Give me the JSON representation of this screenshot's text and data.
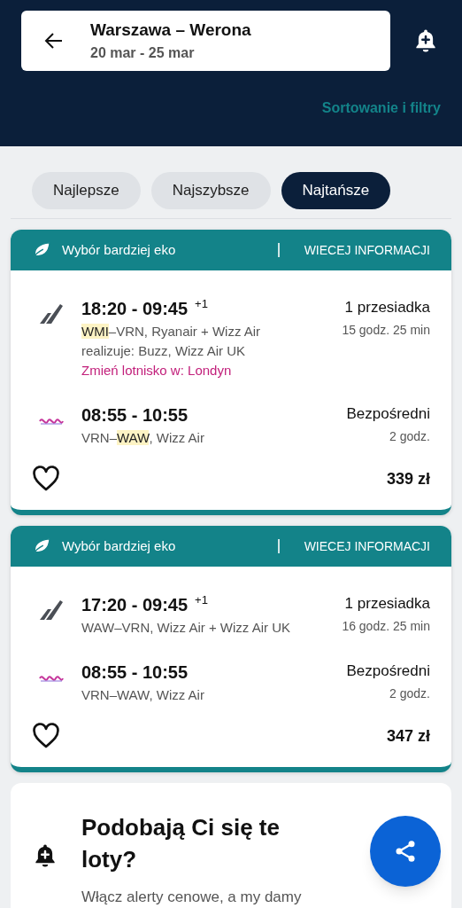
{
  "header": {
    "route": "Warszawa – Werona",
    "dates": "20 mar - 25 mar",
    "sort_filters": "Sortowanie i filtry"
  },
  "tabs": [
    {
      "label": "Najlepsze",
      "selected": false
    },
    {
      "label": "Najszybsze",
      "selected": false
    },
    {
      "label": "Najtańsze",
      "selected": true
    }
  ],
  "results": [
    {
      "eco_label": "Wybór bardziej eko",
      "more_info": "WIECEJ INFORMACJI",
      "price": "339 zł",
      "favorite": false,
      "legs": [
        {
          "kind": "multi",
          "times": "18:20 - 09:45",
          "day_offset": "+1",
          "route": [
            {
              "text": "WMI",
              "highlighted": true
            },
            {
              "text": "–VRN, Ryanair + Wizz Air",
              "highlighted": false
            }
          ],
          "operated_by": "realizuje: Buzz, Wizz Air UK",
          "change_airport": "Zmień lotnisko w: Londyn",
          "stops": "1 przesiadka",
          "duration": "15 godz. 25 min"
        },
        {
          "kind": "wizz",
          "times": "08:55 - 10:55",
          "route": [
            {
              "text": "VRN–",
              "highlighted": false
            },
            {
              "text": "WAW",
              "highlighted": true
            },
            {
              "text": ", Wizz Air",
              "highlighted": false
            }
          ],
          "stops": "Bezpośredni",
          "duration": "2 godz."
        }
      ]
    },
    {
      "eco_label": "Wybór bardziej eko",
      "more_info": "WIECEJ INFORMACJI",
      "price": "347 zł",
      "favorite": false,
      "legs": [
        {
          "kind": "multi",
          "times": "17:20 - 09:45",
          "day_offset": "+1",
          "route": [
            {
              "text": "WAW–VRN, Wizz Air + Wizz Air UK",
              "highlighted": false
            }
          ],
          "stops": "1 przesiadka",
          "duration": "16 godz. 25 min"
        },
        {
          "kind": "wizz",
          "times": "08:55 - 10:55",
          "route": [
            {
              "text": "VRN–WAW, Wizz Air",
              "highlighted": false
            }
          ],
          "stops": "Bezpośredni",
          "duration": "2 godz."
        }
      ]
    }
  ],
  "promo": {
    "title": "Podobają Ci się te loty?",
    "text": "Włącz alerty cenowe, a my damy"
  }
}
